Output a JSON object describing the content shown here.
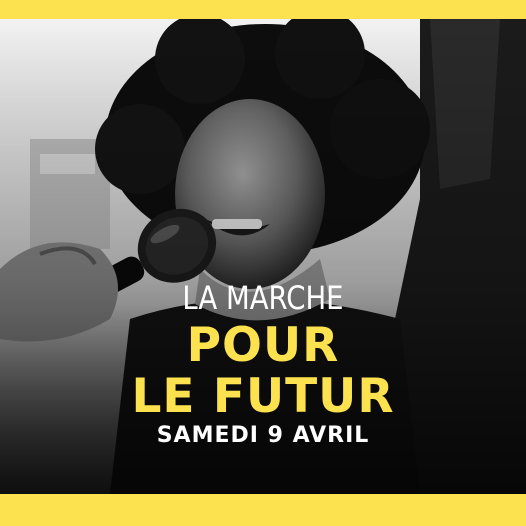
{
  "colors": {
    "accent": "#fde24f",
    "text": "#ffffff",
    "photo_dark": "#111111",
    "photo_light": "#e9e9e9"
  },
  "poster": {
    "line1": "LA MARCHE",
    "line2": "POUR",
    "line3": "LE FUTUR",
    "date": "SAMEDI 9 AVRIL"
  },
  "photo": {
    "icon": "protester-with-microphone-photo"
  }
}
